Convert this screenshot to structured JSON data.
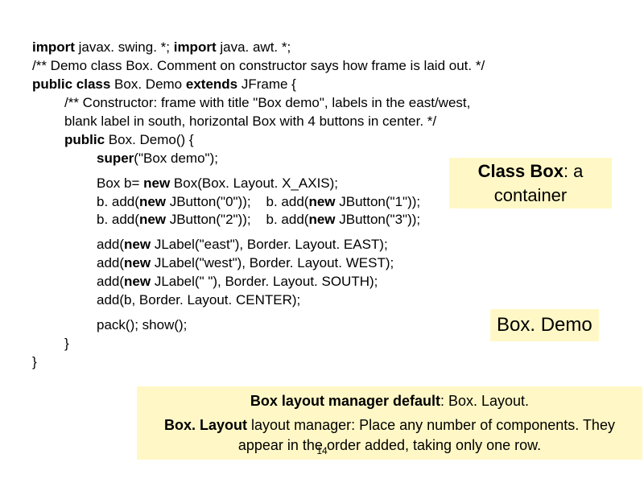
{
  "code": {
    "import1a": "import",
    "import1b": " javax. swing. *;  ",
    "import2a": "import",
    "import2b": " java. awt. *;",
    "comment1": "/** Demo class Box. Comment on constructor says how frame is laid out. */",
    "cls1": "public class",
    "cls2": " Box. Demo ",
    "cls3": "extends",
    "cls4": " JFrame {",
    "ctor_comment": "/** Constructor: frame with title \"Box demo\", labels in the east/west,\n     blank label in south, horizontal Box with 4 buttons in center. */",
    "ctor1": "public",
    "ctor2": " Box. Demo() {",
    "super1": "super",
    "super2": "(\"Box demo\");",
    "box1a": "Box b= ",
    "box1b": "new",
    "box1c": " Box(Box. Layout. X_AXIS);",
    "add0a": "b. add(",
    "add0b": "new",
    "add0c": " JButton(\"0\"));",
    "add1a": "b. add(",
    "add1b": "new",
    "add1c": " JButton(\"1\"));",
    "add2a": "b. add(",
    "add2b": "new",
    "add2c": " JButton(\"2\"));",
    "add3a": "b. add(",
    "add3b": "new",
    "add3c": " JButton(\"3\"));",
    "east1": "add(",
    "east2": "new",
    "east3": " JLabel(\"east\"),  Border. Layout. EAST);",
    "west1": "add(",
    "west2": "new",
    "west3": " JLabel(\"west\"), Border. Layout. WEST);",
    "south1": "add(",
    "south2": "new",
    "south3": " JLabel(\" \"),       Border. Layout. SOUTH);",
    "center": "add(b,                          Border. Layout. CENTER);",
    "pack": "pack();  show();",
    "close1": "}",
    "close2": "}"
  },
  "labels": {
    "class_box_a": "Class Box",
    "class_box_b": ": a container",
    "box_demo": "Box. Demo",
    "bottom1a": "Box layout manager default",
    "bottom1b": ": Box. Layout.",
    "bottom2a": "Box. Layout",
    "bottom2b": " layout manager: Place any number of components. They appear in the order added, taking only one row."
  },
  "page_number": "14"
}
